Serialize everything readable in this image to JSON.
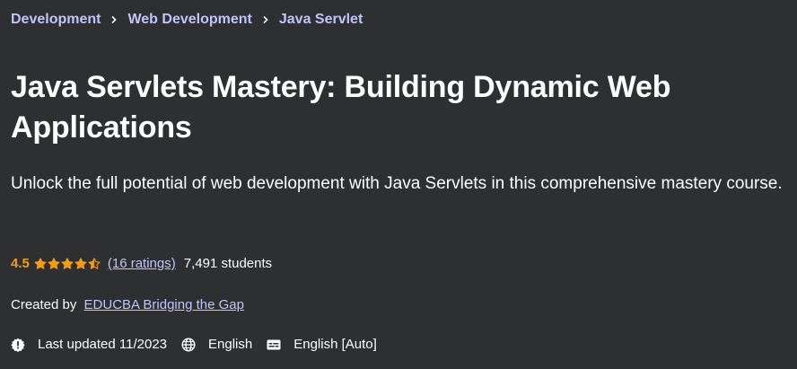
{
  "breadcrumb": {
    "items": [
      {
        "label": "Development"
      },
      {
        "label": "Web Development"
      },
      {
        "label": "Java Servlet"
      }
    ]
  },
  "course": {
    "title": "Java Servlets Mastery: Building Dynamic Web Applications",
    "subtitle": "Unlock the full potential of web development with Java Servlets in this comprehensive mastery course."
  },
  "rating": {
    "value": "4.5",
    "stars": 4.5,
    "ratings_count_label": "(16 ratings)",
    "students_label": "7,491 students"
  },
  "creator": {
    "prefix": "Created by",
    "name": "EDUCBA Bridging the Gap"
  },
  "meta": {
    "last_updated": "Last updated 11/2023",
    "language": "English",
    "captions": "English [Auto]"
  },
  "colors": {
    "background": "#2d2f31",
    "link": "#c0c4fc",
    "rating": "#f69c08",
    "text": "#ffffff"
  },
  "icons": {
    "separator": "chevron-right-icon",
    "updated": "alert-badge-icon",
    "language": "globe-icon",
    "captions": "closed-captions-icon"
  }
}
